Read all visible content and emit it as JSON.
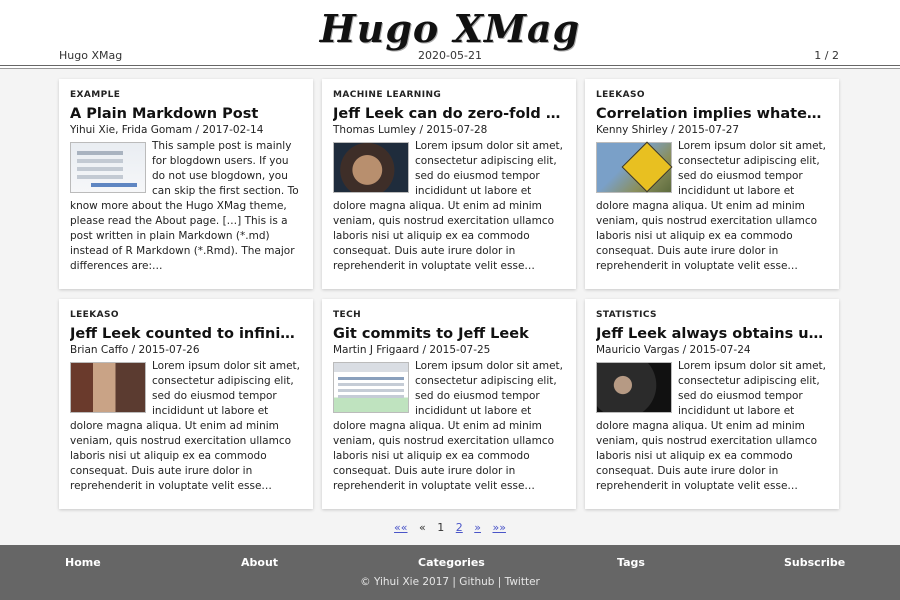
{
  "header": {
    "site_title": "Hugo XMag",
    "left": "Hugo XMag",
    "date": "2020-05-21",
    "page_indicator": "1 / 2"
  },
  "cards": [
    {
      "category": "EXAMPLE",
      "title": "A Plain Markdown Post",
      "byline": "Yihui Xie, Frida Gomam / 2017-02-14",
      "thumb": "doc-screenshot-thumbnail",
      "summary": "This sample post is mainly for blogdown users. If you do not use blogdown, you can skip the first section. To know more about the Hugo XMag theme, please read the About page. […] This is a post written in plain Markdown (*.md) instead of R Markdown (*.Rmd). The major differences are:…"
    },
    {
      "category": "MACHINE LEARNING",
      "title": "Jeff Leek can do zero-fold cr…",
      "byline": "Thomas Lumley / 2015-07-28",
      "thumb": "face-photo-thumbnail",
      "summary": "Lorem ipsum dolor sit amet, consectetur adipiscing elit, sed do eiusmod tempor incididunt ut labore et dolore magna aliqua. Ut enim ad minim veniam, quis nostrud exercitation ullamco laboris nisi ut aliquip ex ea commodo consequat. Duis aute irure dolor in reprehenderit in voluptate velit esse…"
    },
    {
      "category": "LEEKASO",
      "title": "Correlation implies whateve…",
      "byline": "Kenny Shirley / 2015-07-27",
      "thumb": "road-sign-thumbnail",
      "summary": "Lorem ipsum dolor sit amet, consectetur adipiscing elit, sed do eiusmod tempor incididunt ut labore et dolore magna aliqua. Ut enim ad minim veniam, quis nostrud exercitation ullamco laboris nisi ut aliquip ex ea commodo consequat. Duis aute irure dolor in reprehenderit in voluptate velit esse…"
    },
    {
      "category": "LEEKASO",
      "title": "Jeff Leek counted to infinity.…",
      "byline": "Brian Caffo / 2015-07-26",
      "thumb": "movie-still-thumbnail",
      "summary": "Lorem ipsum dolor sit amet, consectetur adipiscing elit, sed do eiusmod tempor incididunt ut labore et dolore magna aliqua. Ut enim ad minim veniam, quis nostrud exercitation ullamco laboris nisi ut aliquip ex ea commodo consequat. Duis aute irure dolor in reprehenderit in voluptate velit esse…"
    },
    {
      "category": "TECH",
      "title": "Git commits to Jeff Leek",
      "byline": "Martin J Frigaard / 2015-07-25",
      "thumb": "software-window-thumbnail",
      "summary": "Lorem ipsum dolor sit amet, consectetur adipiscing elit, sed do eiusmod tempor incididunt ut labore et dolore magna aliqua. Ut enim ad minim veniam, quis nostrud exercitation ullamco laboris nisi ut aliquip ex ea commodo consequat. Duis aute irure dolor in reprehenderit in voluptate velit esse…"
    },
    {
      "category": "STATISTICS",
      "title": "Jeff Leek always obtains unb…",
      "byline": "Mauricio Vargas / 2015-07-24",
      "thumb": "dark-photo-thumbnail",
      "summary": "Lorem ipsum dolor sit amet, consectetur adipiscing elit, sed do eiusmod tempor incididunt ut labore et dolore magna aliqua. Ut enim ad minim veniam, quis nostrud exercitation ullamco laboris nisi ut aliquip ex ea commodo consequat. Duis aute irure dolor in reprehenderit in voluptate velit esse…"
    }
  ],
  "pager": {
    "first": "««",
    "prev": "«",
    "current": "1",
    "next_page": "2",
    "next": "»",
    "last": "»»"
  },
  "footer": {
    "nav": [
      "Home",
      "About",
      "Categories",
      "Tags",
      "Subscribe"
    ],
    "copyright": "© Yihui Xie 2017 | Github | Twitter"
  }
}
